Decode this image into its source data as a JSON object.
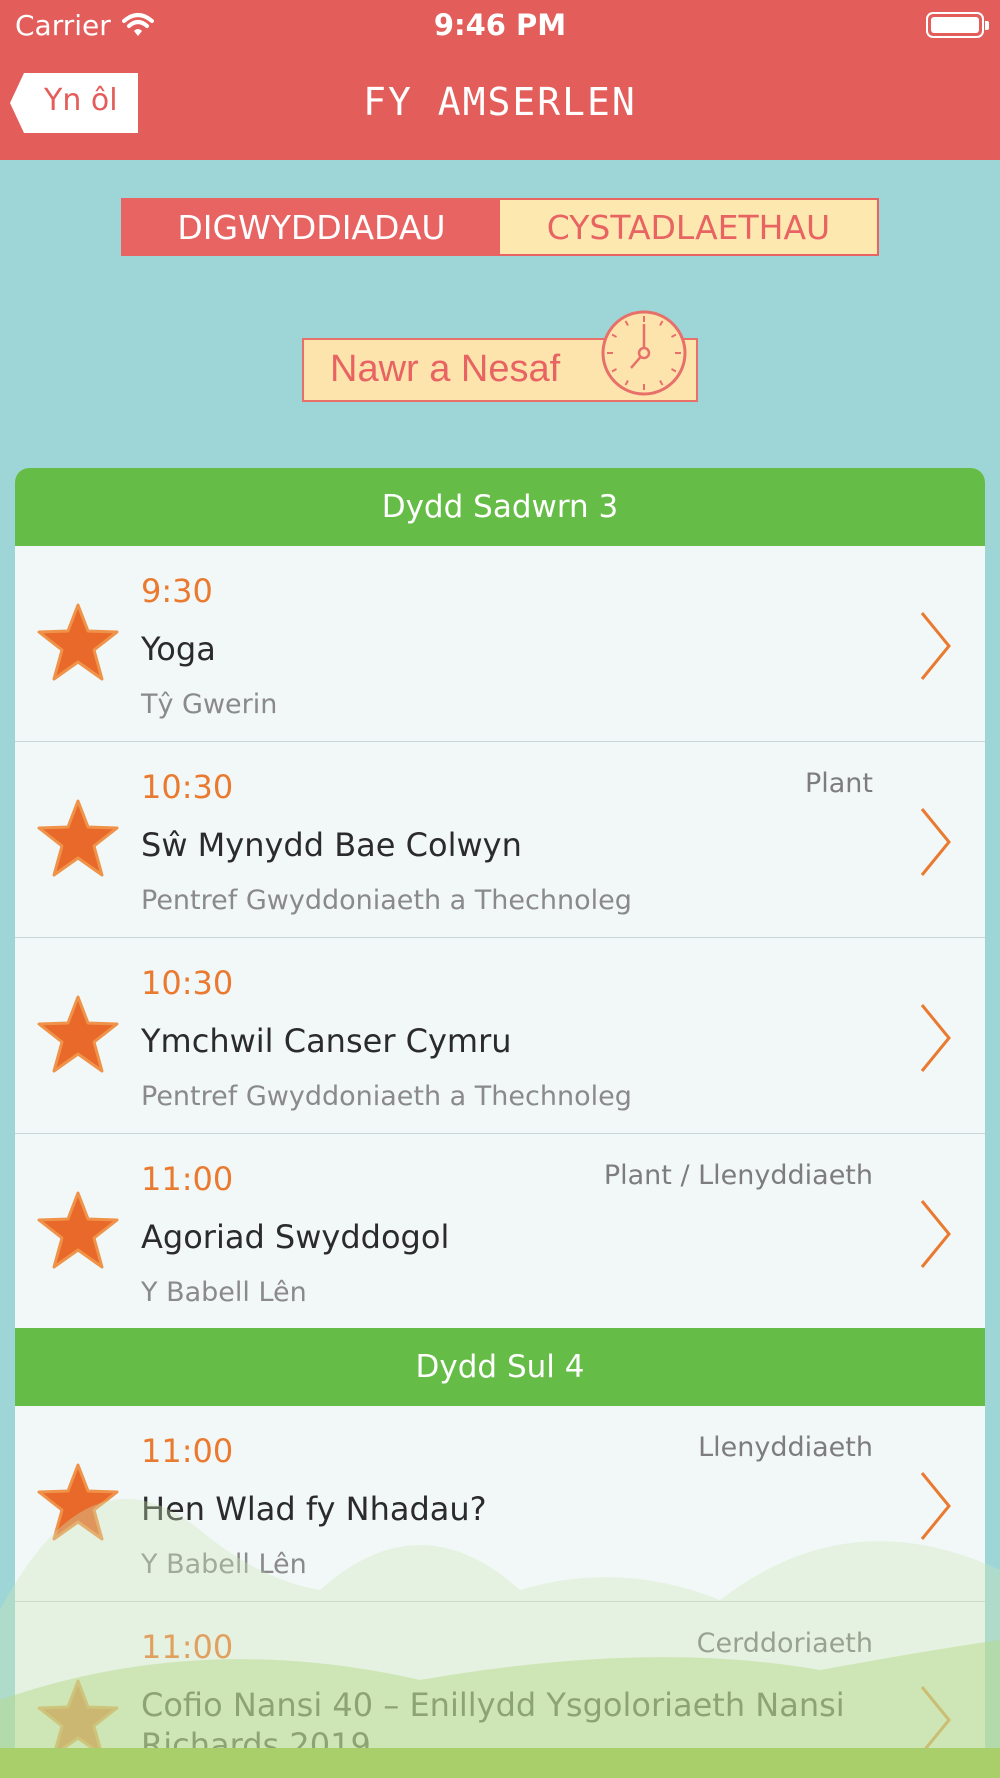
{
  "status_bar": {
    "carrier": "Carrier",
    "time": "9:46 PM"
  },
  "nav": {
    "back_label": "Yn ôl",
    "title": "FY AMSERLEN"
  },
  "segments": [
    {
      "label": "DIGWYDDIADAU",
      "selected": true
    },
    {
      "label": "CYSTADLAETHAU",
      "selected": false
    }
  ],
  "now_next_label": "Nawr a Nesaf",
  "days": [
    {
      "header": "Dydd Sadwrn 3",
      "events": [
        {
          "time": "9:30",
          "category": "",
          "title": "Yoga",
          "venue": "Tŷ Gwerin"
        },
        {
          "time": "10:30",
          "category": "Plant",
          "title": "Sŵ Mynydd Bae Colwyn",
          "venue": "Pentref Gwyddoniaeth a Thechnoleg"
        },
        {
          "time": "10:30",
          "category": "",
          "title": "Ymchwil Canser Cymru",
          "venue": "Pentref Gwyddoniaeth a Thechnoleg"
        },
        {
          "time": "11:00",
          "category": "Plant / Llenyddiaeth",
          "title": "Agoriad Swyddogol",
          "venue": "Y Babell Lên"
        }
      ]
    },
    {
      "header": "Dydd Sul 4",
      "events": [
        {
          "time": "11:00",
          "category": "Llenyddiaeth",
          "title": "Hen Wlad fy Nhadau?",
          "venue": "Y Babell Lên"
        },
        {
          "time": "11:00",
          "category": "Cerddoriaeth",
          "title": "Cofio Nansi 40 – Enillydd Ysgoloriaeth Nansi Richards 2019",
          "venue": ""
        }
      ]
    }
  ],
  "colors": {
    "header_red": "#e35e5b",
    "background_teal": "#9ed5d6",
    "section_green": "#65bd47",
    "accent_orange": "#ea7a30",
    "star_orange": "#e8692a",
    "segment_cream": "#fde8b0"
  },
  "icons": {
    "wifi": "wifi-icon",
    "battery": "battery-icon",
    "back": "back-arrow-icon",
    "clock": "clock-icon",
    "favorite": "star-icon",
    "disclosure": "chevron-right-icon"
  }
}
